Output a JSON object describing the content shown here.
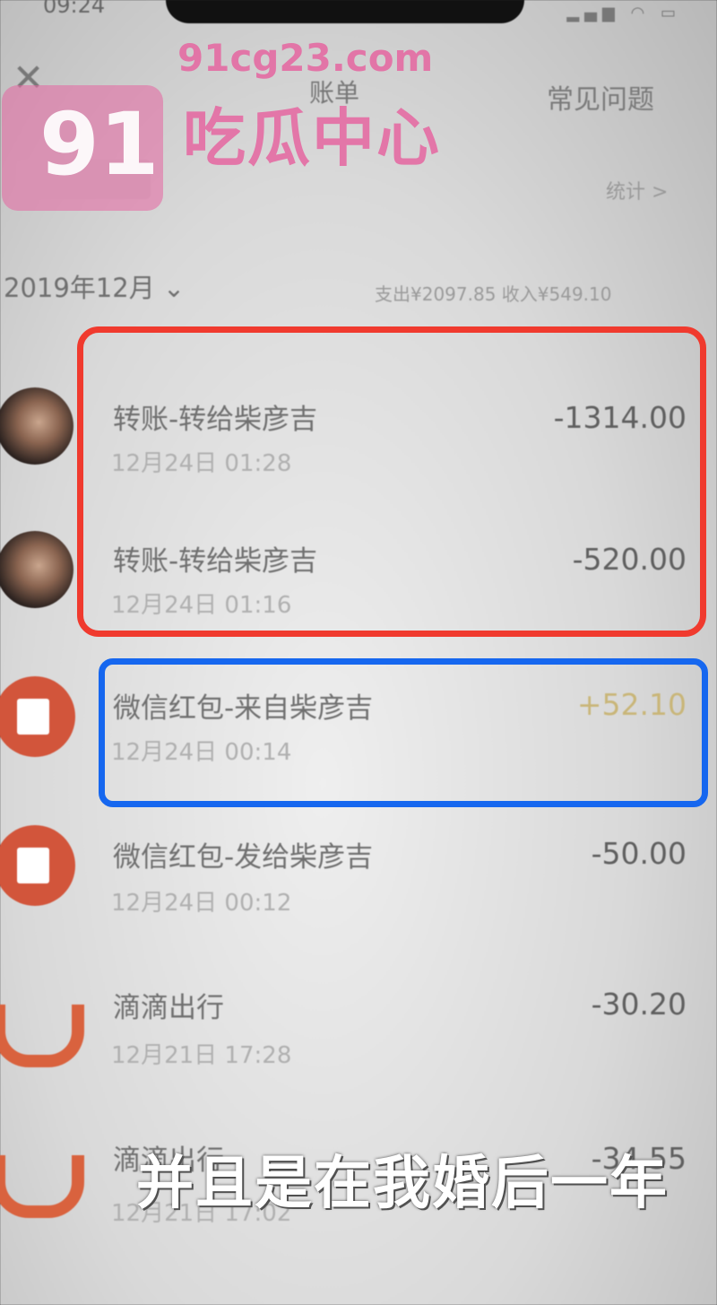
{
  "status": {
    "time": "09:24"
  },
  "header": {
    "title": "账单",
    "faq_label": "常见问题"
  },
  "filter": {
    "stats_label": "统计 >"
  },
  "month": {
    "label": "2019年12月",
    "summary": "支出¥2097.85 收入¥549.10"
  },
  "transactions": [
    {
      "title": "转账-转给柴彦吉",
      "time": "12月24日 01:28",
      "amount": "-1314.00",
      "icon": "avatar",
      "type": "expense"
    },
    {
      "title": "转账-转给柴彦吉",
      "time": "12月24日 01:16",
      "amount": "-520.00",
      "icon": "avatar",
      "type": "expense"
    },
    {
      "title": "微信红包-来自柴彦吉",
      "time": "12月24日 00:14",
      "amount": "+52.10",
      "icon": "red-envelope-icon",
      "type": "income"
    },
    {
      "title": "微信红包-发给柴彦吉",
      "time": "12月24日 00:12",
      "amount": "-50.00",
      "icon": "red-envelope-icon",
      "type": "expense"
    },
    {
      "title": "滴滴出行",
      "time": "12月21日 17:28",
      "amount": "-30.20",
      "icon": "didi-icon",
      "type": "expense"
    },
    {
      "title": "滴滴出行",
      "time": "12月21日 17:02",
      "amount": "-34.55",
      "icon": "didi-icon",
      "type": "expense"
    }
  ],
  "highlights": {
    "red": "#f03a2e",
    "blue": "#1667ef"
  },
  "watermark": {
    "logo": "91",
    "url": "91cg23.com",
    "text": "吃瓜中心"
  },
  "caption": "并且是在我婚后一年"
}
